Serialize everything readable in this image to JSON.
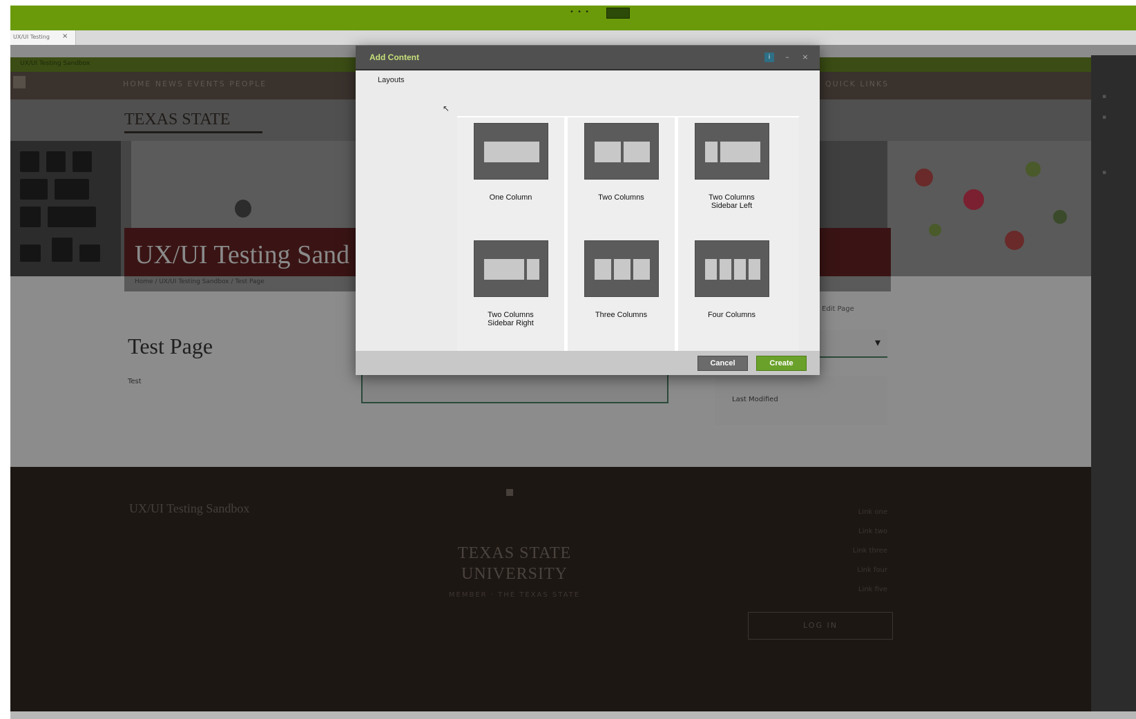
{
  "browser": {
    "top_dots": "• • •",
    "tab_label": "UX/UI Testing",
    "tab_close": "×"
  },
  "site": {
    "topstrip_text": "UX/UI Testing Sandbox",
    "nav_items": "HOME  NEWS  EVENTS  PEOPLE",
    "nav_items_right": "QUICK LINKS",
    "logo_text": "TEXAS STATE",
    "hero_title": "UX/UI Testing Sand",
    "breadcrumb": "Home / UX/UI Testing Sandbox / Test Page",
    "page_heading": "Test Page",
    "page_sub": "Test",
    "right_panel_label": "Edit Page",
    "right_box_text": "Last Modified"
  },
  "footer": {
    "title": "UX/UI Testing Sandbox",
    "logo_line1": "TEXAS STATE",
    "logo_line2": "UNIVERSITY",
    "logo_sub": "MEMBER · THE TEXAS STATE",
    "links": [
      "Link one",
      "Link two",
      "Link three",
      "Link four",
      "Link five"
    ],
    "button": "LOG IN"
  },
  "modal": {
    "title": "Add Content",
    "tab": "Layouts",
    "icons": {
      "info": "i",
      "minimize": "–",
      "close": "×"
    },
    "layouts": [
      {
        "label": "One Column",
        "blocks": [
          1
        ]
      },
      {
        "label": "Two Columns",
        "blocks": [
          1,
          1
        ]
      },
      {
        "label": "Two Columns\nSidebar Left",
        "blocks": [
          0.3,
          1
        ]
      },
      {
        "label": "Two Columns\nSidebar Right",
        "blocks": [
          1,
          0.3
        ]
      },
      {
        "label": "Three Columns",
        "blocks": [
          1,
          1,
          1
        ]
      },
      {
        "label": "Four Columns",
        "blocks": [
          1,
          1,
          1,
          1
        ]
      }
    ],
    "cancel_label": "Cancel",
    "create_label": "Create"
  },
  "colors": {
    "accent": "#6aa12a",
    "title_accent": "#c6e07a",
    "browser_bar": "#6a9a0a"
  }
}
